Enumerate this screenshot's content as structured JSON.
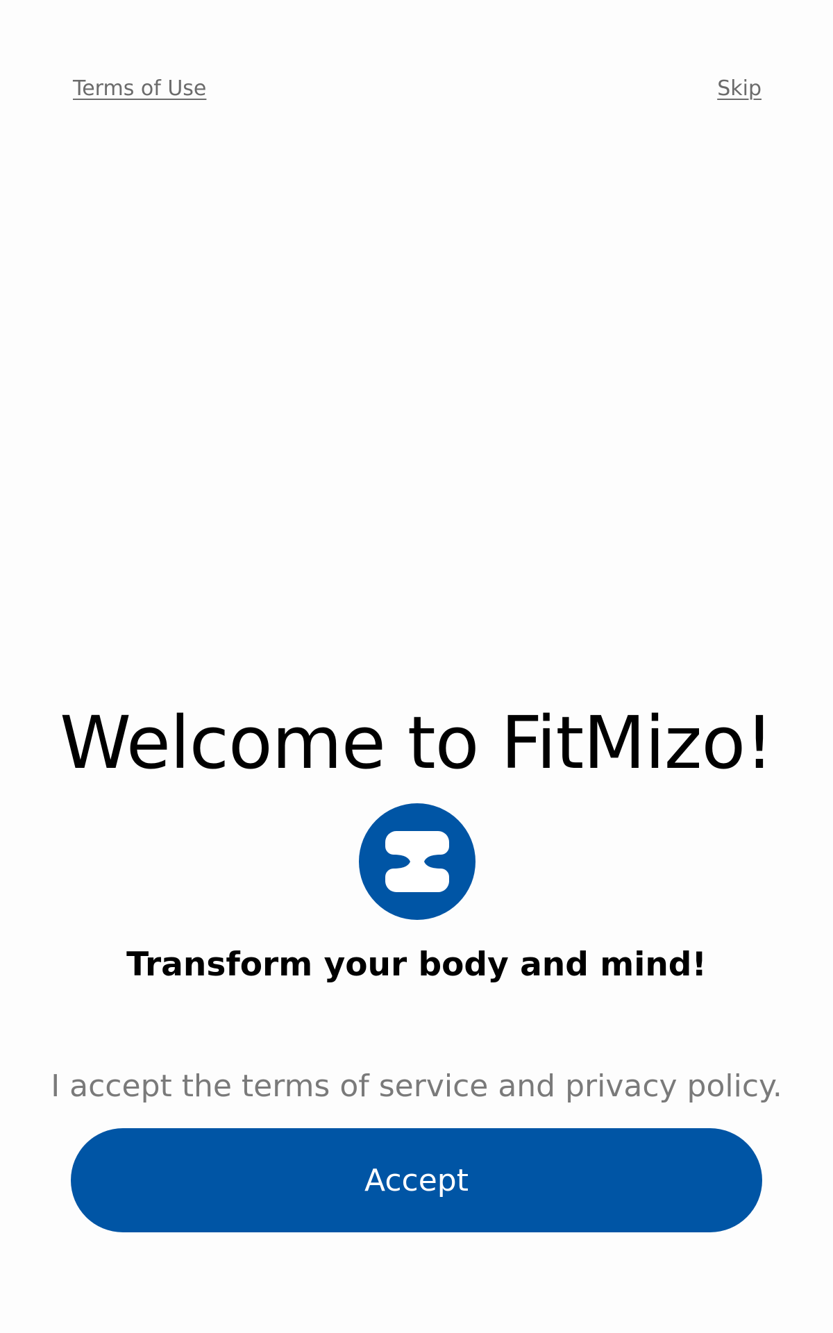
{
  "header": {
    "terms_label": "Terms of Use",
    "skip_label": "Skip"
  },
  "main": {
    "title": "Welcome to FitMizo!",
    "logo_icon": "fitmizo-logo-icon",
    "tagline": "Transform your body and mind!",
    "consent_text": "I accept the terms of service and privacy policy.",
    "accept_label": "Accept"
  },
  "colors": {
    "brand": "#0055a5",
    "link": "#6b6b6b",
    "muted_text": "#7a7a7a",
    "background": "#fdfdfd"
  }
}
